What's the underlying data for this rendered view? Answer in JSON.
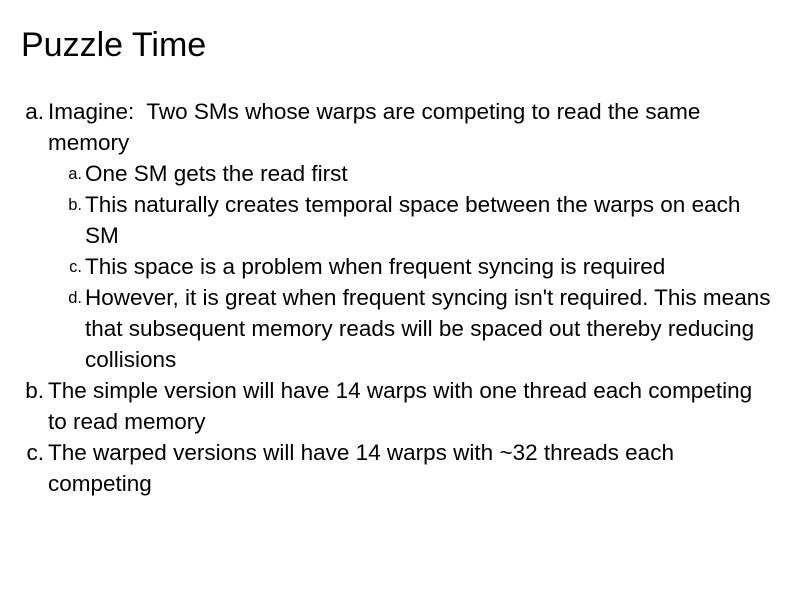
{
  "slide": {
    "title": "Puzzle Time",
    "background_color": "#ffffff",
    "text_color": "#000000",
    "outline": [
      {
        "level": 1,
        "marker": "a.",
        "text": "Imagine:  Two SMs whose warps are competing to read the same memory"
      },
      {
        "level": 2,
        "marker": "a.",
        "text": "One SM gets the read first"
      },
      {
        "level": 2,
        "marker": "b.",
        "text": "This naturally creates temporal space between the warps on each SM"
      },
      {
        "level": 2,
        "marker": "c.",
        "text": "This space is a problem when frequent syncing is required"
      },
      {
        "level": 2,
        "marker": "d.",
        "text": "However, it is great when frequent syncing isn't required. This means that subsequent memory reads will be spaced out thereby reducing collisions"
      },
      {
        "level": 1,
        "marker": "b.",
        "text": "The simple version will have 14 warps with one thread each competing to read memory"
      },
      {
        "level": 1,
        "marker": "c.",
        "text": "The warped versions will have 14 warps with ~32 threads each competing"
      }
    ]
  }
}
